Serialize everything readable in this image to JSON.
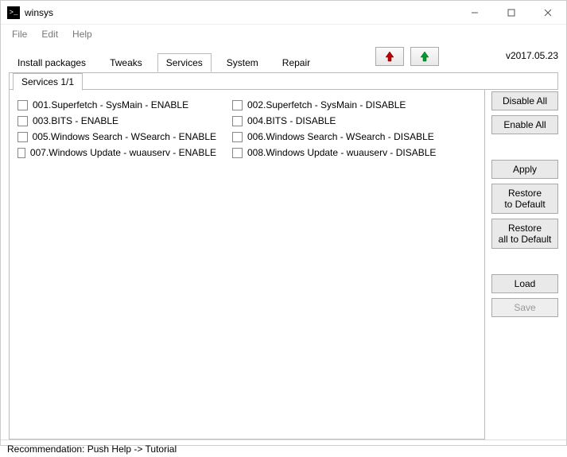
{
  "window": {
    "title": "winsys"
  },
  "menu": {
    "file": "File",
    "edit": "Edit",
    "help": "Help"
  },
  "tabs": {
    "install": "Install packages",
    "tweaks": "Tweaks",
    "services": "Services",
    "system": "System",
    "repair": "Repair"
  },
  "version": "v2017.05.23",
  "subtab": "Services 1/1",
  "services": {
    "left": [
      "001.Superfetch - SysMain - ENABLE",
      "003.BITS - ENABLE",
      "005.Windows Search - WSearch - ENABLE",
      "007.Windows Update - wuauserv - ENABLE"
    ],
    "right": [
      "002.Superfetch - SysMain - DISABLE",
      "004.BITS - DISABLE",
      "006.Windows Search - WSearch - DISABLE",
      "008.Windows Update - wuauserv - DISABLE"
    ]
  },
  "buttons": {
    "disable_all": "Disable All",
    "enable_all": "Enable All",
    "apply": "Apply",
    "restore_default": "Restore\nto Default",
    "restore_all_default": "Restore\nall to Default",
    "load": "Load",
    "save": "Save"
  },
  "status": "Recommendation: Push Help -> Tutorial",
  "colors": {
    "arrow_up": "#c00000",
    "arrow_down": "#009933"
  }
}
